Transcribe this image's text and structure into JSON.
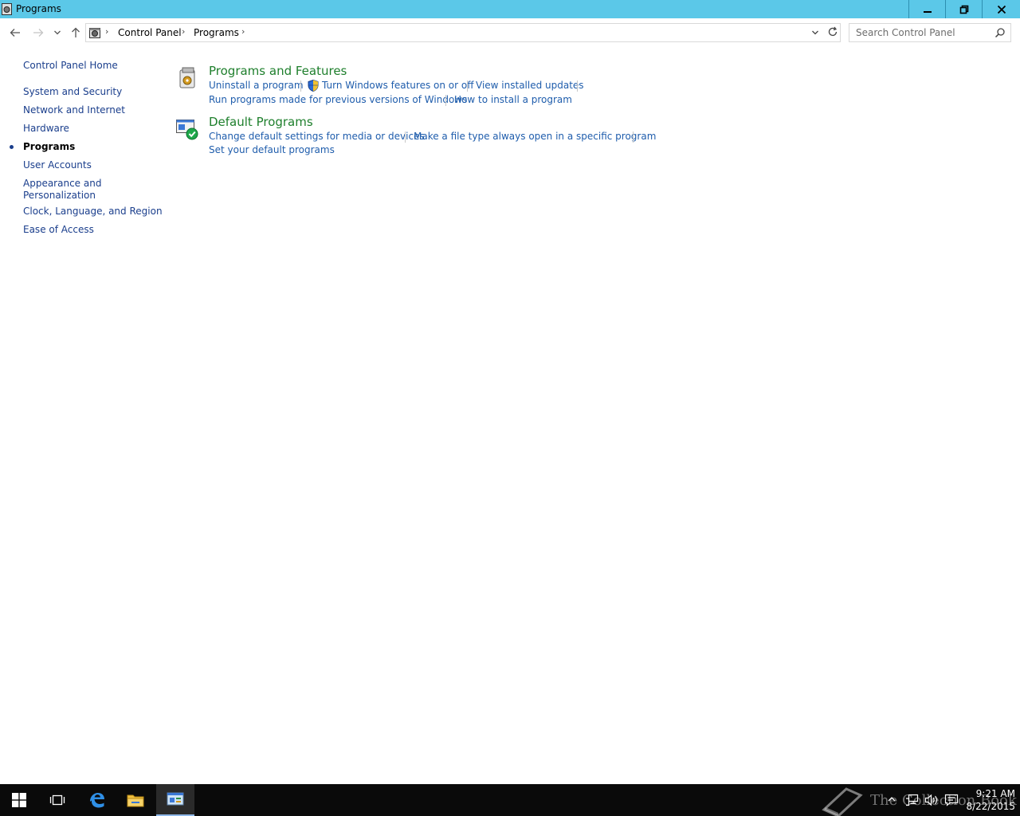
{
  "window": {
    "title": "Programs",
    "controls": {
      "minimize": "minimize",
      "restore": "restore",
      "close": "close"
    }
  },
  "address": {
    "breadcrumbs": [
      "Control Panel",
      "Programs"
    ]
  },
  "search": {
    "placeholder": "Search Control Panel"
  },
  "sidebar": {
    "home": "Control Panel Home",
    "items": [
      {
        "label": "System and Security",
        "active": false
      },
      {
        "label": "Network and Internet",
        "active": false
      },
      {
        "label": "Hardware",
        "active": false
      },
      {
        "label": "Programs",
        "active": true
      },
      {
        "label": "User Accounts",
        "active": false
      },
      {
        "label": "Appearance and Personalization",
        "line1": "Appearance and",
        "line2": "Personalization",
        "active": false
      },
      {
        "label": "Clock, Language, and Region",
        "active": false
      },
      {
        "label": "Ease of Access",
        "active": false
      }
    ]
  },
  "sections": [
    {
      "title": "Programs and Features",
      "tasks": [
        "Uninstall a program",
        "Turn Windows features on or off",
        "View installed updates",
        "Run programs made for previous versions of Windows",
        "How to install a program"
      ]
    },
    {
      "title": "Default Programs",
      "tasks": [
        "Change default settings for media or devices",
        "Make a file type always open in a specific program",
        "Set your default programs"
      ]
    }
  ],
  "taskbar": {
    "watermark": "The Collection Book",
    "time": "9:21 AM",
    "date": "8/22/2015"
  },
  "colors": {
    "titlebar": "#5bc8e8",
    "link": "#1f5dac",
    "section_title": "#1e7f2c",
    "taskbar": "#0a0a0a"
  }
}
